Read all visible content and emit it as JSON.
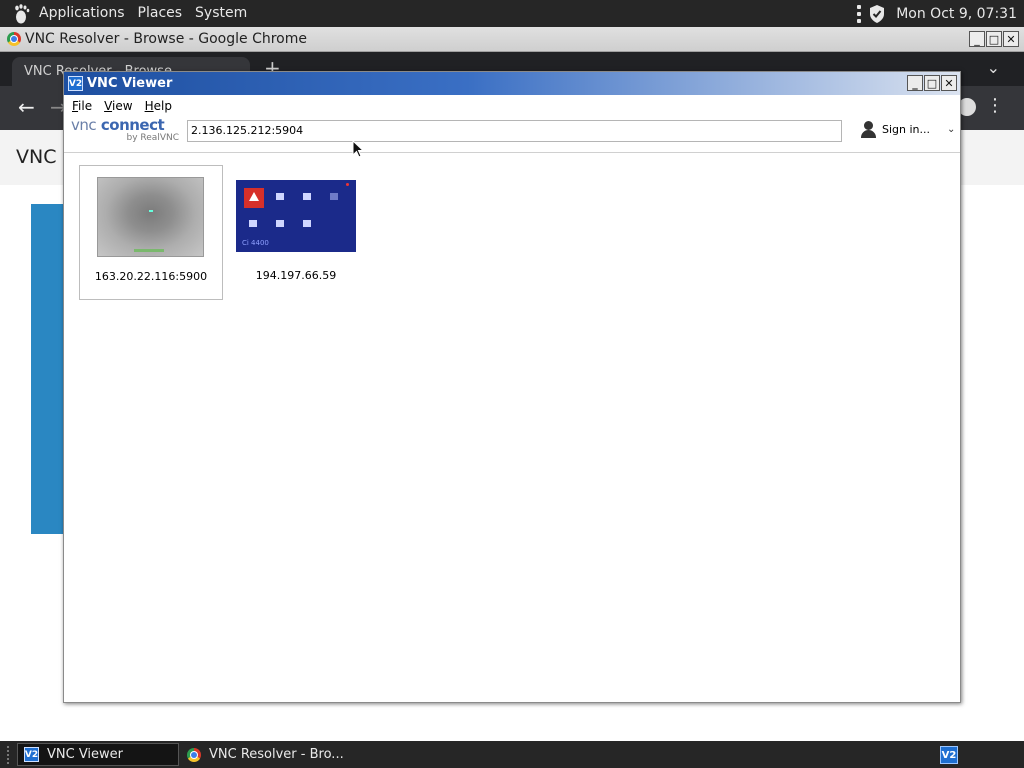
{
  "top_panel": {
    "menus": [
      "Applications",
      "Places",
      "System"
    ],
    "clock": "Mon Oct  9, 07:31"
  },
  "chrome": {
    "window_title": "VNC Resolver - Browse - Google Chrome",
    "tab_title": "VNC Resolver - Browse",
    "page_heading": "VNC",
    "new_tab": "+",
    "tab_search": "⌄",
    "back": "←",
    "forward": "→",
    "more": "⋮"
  },
  "vnc_viewer": {
    "window_title": "VNC Viewer",
    "app_icon": "V2",
    "menu": [
      "File",
      "View",
      "Help"
    ],
    "brand": {
      "line1_a": "vnc",
      "line1_b": "connect",
      "line2": "by RealVNC"
    },
    "address_value": "2.136.125.212:5904",
    "signin_label": "Sign in...",
    "connections": [
      {
        "label": "163.20.22.116:5900",
        "selected": true
      },
      {
        "label": "194.197.66.59",
        "selected": false
      }
    ],
    "thumb2_caption": "Ci 4400"
  },
  "window_buttons": {
    "minimize": "_",
    "maximize": "□",
    "close": "✕"
  },
  "taskbar": {
    "items": [
      {
        "label": "VNC Viewer",
        "icon": "vnc-icon",
        "active": true
      },
      {
        "label": "VNC Resolver - Bro...",
        "icon": "chrome-icon",
        "active": false
      }
    ],
    "tray_icon": "V2"
  },
  "colors": {
    "panel_bg": "#262626",
    "vnc_title_blue": "#1e4fa0",
    "vnc_brand_blue": "#3b66b0",
    "thumb2_bg": "#1b2a8a",
    "page_accent": "#2a87c2"
  }
}
